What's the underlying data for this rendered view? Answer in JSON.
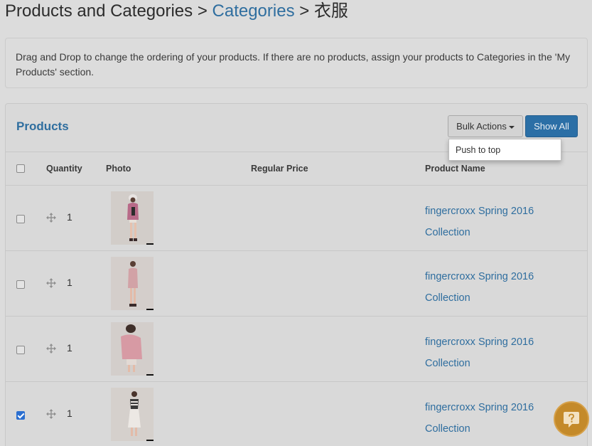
{
  "breadcrumb": {
    "root": "Products and Categories",
    "separator": ">",
    "middle": "Categories",
    "current": "衣服"
  },
  "info": {
    "text": "Drag and Drop to change the ordering of your products. If there are no products, assign your products to Categories in the 'My Products' section."
  },
  "panel": {
    "title": "Products",
    "bulk_actions_label": "Bulk Actions",
    "show_all_label": "Show All",
    "dropdown_items": [
      "Push to top"
    ]
  },
  "table": {
    "headers": {
      "quantity": "Quantity",
      "photo": "Photo",
      "regular_price": "Regular Price",
      "product_name": "Product Name"
    },
    "rows": [
      {
        "quantity": "1",
        "checked": false,
        "name_line1": "fingercroxx Spring 2016",
        "name_line2": "Collection"
      },
      {
        "quantity": "1",
        "checked": false,
        "name_line1": "fingercroxx Spring 2016",
        "name_line2": "Collection"
      },
      {
        "quantity": "1",
        "checked": false,
        "name_line1": "fingercroxx Spring 2016",
        "name_line2": "Collection"
      },
      {
        "quantity": "1",
        "checked": true,
        "name_line1": "fingercroxx Spring 2016",
        "name_line2": "Collection"
      }
    ]
  },
  "colors": {
    "accent": "#2f6e9f",
    "primary_button": "#2b6fa6",
    "help_button": "#c48a2a"
  },
  "icons": {
    "move": "move-icon",
    "help": "help-chat-icon",
    "caret": "caret-down-icon"
  }
}
